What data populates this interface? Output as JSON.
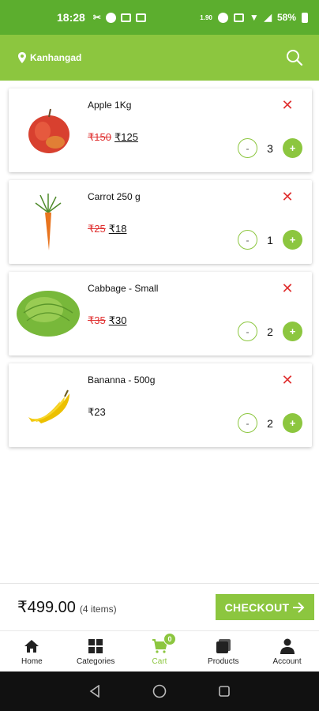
{
  "status_bar": {
    "time": "18:28",
    "net_speed": "1.90",
    "battery": "58%"
  },
  "header": {
    "location": "Kanhangad",
    "search_icon": "search-icon"
  },
  "cart": {
    "items": [
      {
        "name": "Apple 1Kg",
        "price_old": "₹150",
        "price_new": "₹125",
        "quantity": "3",
        "image": "apple"
      },
      {
        "name": "Carrot 250 g",
        "price_old": "₹25",
        "price_new": "₹18",
        "quantity": "1",
        "image": "carrot"
      },
      {
        "name": "Cabbage - Small",
        "price_old": "₹35",
        "price_new": "₹30",
        "quantity": "2",
        "image": "cabbage"
      },
      {
        "name": "Bananna - 500g",
        "price_old": "",
        "price_new": "₹23",
        "quantity": "2",
        "image": "banana"
      }
    ],
    "remove_symbol": "✕",
    "minus_symbol": "-",
    "plus_symbol": "+"
  },
  "checkout": {
    "total": "₹499.00",
    "count": "(4 items)",
    "button_label": "CHECKOUT"
  },
  "bottom_nav": {
    "items": [
      {
        "label": "Home",
        "icon": "home-icon"
      },
      {
        "label": "Categories",
        "icon": "grid-icon"
      },
      {
        "label": "Cart",
        "icon": "cart-icon",
        "badge": "0"
      },
      {
        "label": "Products",
        "icon": "products-icon"
      },
      {
        "label": "Account",
        "icon": "user-icon"
      }
    ]
  },
  "colors": {
    "status_bar": "#5cae2e",
    "primary": "#8cc63f",
    "strike_price": "#e03131"
  }
}
